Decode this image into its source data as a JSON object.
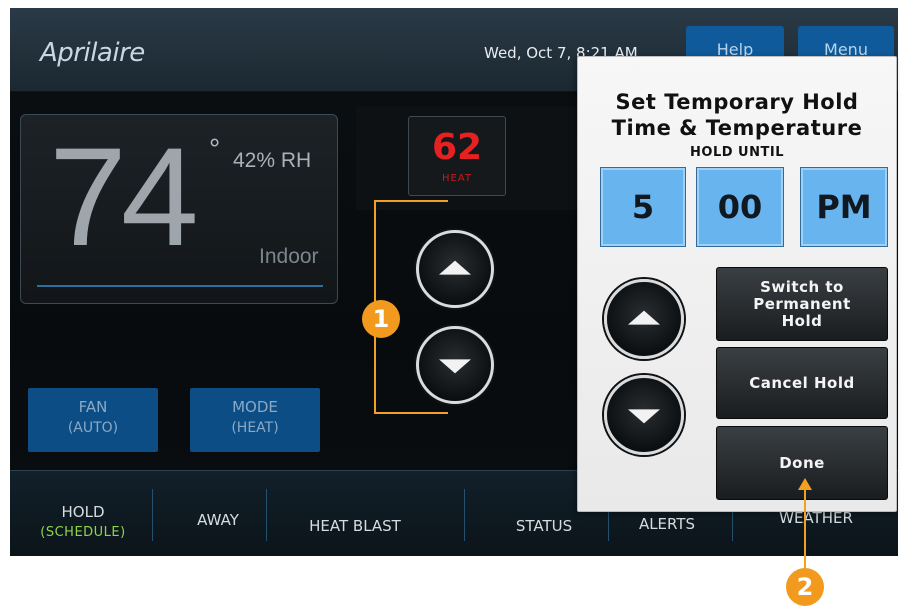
{
  "topbar": {
    "brand": "Aprilaire",
    "datetime": "Wed, Oct 7, 8:21 AM",
    "help_label": "Help",
    "menu_label": "Menu"
  },
  "current": {
    "temperature": "74",
    "degree_symbol": "°",
    "humidity": "42% RH",
    "location_label": "Indoor"
  },
  "setpoint": {
    "value": "62",
    "mode": "HEAT"
  },
  "fan": {
    "label": "FAN",
    "value": "(AUTO)"
  },
  "mode": {
    "label": "MODE",
    "value": "(HEAT)"
  },
  "bottom_nav": {
    "hold": "HOLD",
    "hold_sub": "(SCHEDULE)",
    "away": "AWAY",
    "heat_blast": "HEAT BLAST",
    "status": "STATUS",
    "alerts": "ALERTS",
    "weather": "WEATHER"
  },
  "dialog": {
    "title_line1": "Set Temporary Hold",
    "title_line2": "Time & Temperature",
    "hold_until": "HOLD UNTIL",
    "hour": "5",
    "minute": "00",
    "ampm": "PM",
    "switch_permanent_line1": "Switch to",
    "switch_permanent_line2": "Permanent",
    "switch_permanent_line3": "Hold",
    "cancel_hold": "Cancel Hold",
    "done": "Done"
  },
  "annotations": {
    "callout_1": "1",
    "callout_2": "2"
  },
  "colors": {
    "accent_blue": "#0c4d85",
    "time_box_blue": "#68b4ef",
    "setpoint_red": "#e52121",
    "hold_green": "#8fd24c",
    "annotation_orange": "#f29a1e"
  }
}
